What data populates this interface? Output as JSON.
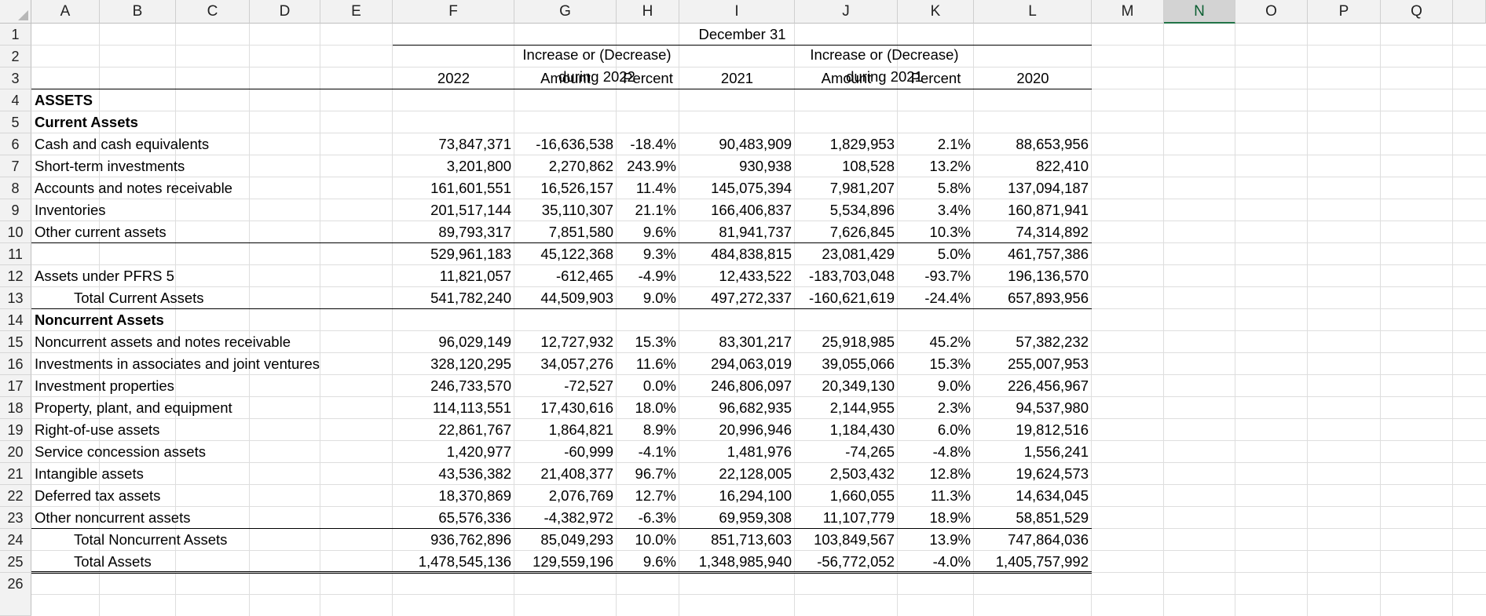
{
  "columns": [
    "A",
    "B",
    "C",
    "D",
    "E",
    "F",
    "G",
    "H",
    "I",
    "J",
    "K",
    "L",
    "M",
    "N",
    "O",
    "P",
    "Q"
  ],
  "selected_column": "N",
  "rows": [
    "1",
    "2",
    "3",
    "4",
    "5",
    "6",
    "7",
    "8",
    "9",
    "10",
    "11",
    "12",
    "13",
    "14",
    "15",
    "16",
    "17",
    "18",
    "19",
    "20",
    "21",
    "22",
    "23",
    "24",
    "25",
    "26"
  ],
  "header": {
    "december": "December 31",
    "inc_2022_line1": "Increase or (Decrease)",
    "inc_2022_line2": "during 2022",
    "inc_2021_line1": "Increase or (Decrease)",
    "inc_2021_line2": "during 2021",
    "y2022": "2022",
    "amount_2022": "Amount",
    "percent_2022": "Percent",
    "y2021": "2021",
    "amount_2021": "Amount",
    "percent_2021": "Percent",
    "y2020": "2020"
  },
  "section_labels": {
    "assets": "ASSETS",
    "current_assets": "Current Assets",
    "noncurrent_assets": "Noncurrent Assets"
  },
  "data_rows": [
    {
      "row": 6,
      "label": "Cash and cash equivalents",
      "indent": false,
      "v2022": "73,847,371",
      "a2022": "-16,636,538",
      "p2022": "-18.4%",
      "v2021": "90,483,909",
      "a2021": "1,829,953",
      "p2021": "2.1%",
      "v2020": "88,653,956"
    },
    {
      "row": 7,
      "label": "Short-term investments",
      "indent": false,
      "v2022": "3,201,800",
      "a2022": "2,270,862",
      "p2022": "243.9%",
      "v2021": "930,938",
      "a2021": "108,528",
      "p2021": "13.2%",
      "v2020": "822,410"
    },
    {
      "row": 8,
      "label": "Accounts and notes receivable",
      "indent": false,
      "v2022": "161,601,551",
      "a2022": "16,526,157",
      "p2022": "11.4%",
      "v2021": "145,075,394",
      "a2021": "7,981,207",
      "p2021": "5.8%",
      "v2020": "137,094,187"
    },
    {
      "row": 9,
      "label": "Inventories",
      "indent": false,
      "v2022": "201,517,144",
      "a2022": "35,110,307",
      "p2022": "21.1%",
      "v2021": "166,406,837",
      "a2021": "5,534,896",
      "p2021": "3.4%",
      "v2020": "160,871,941"
    },
    {
      "row": 10,
      "label": "Other current assets",
      "indent": false,
      "v2022": "89,793,317",
      "a2022": "7,851,580",
      "p2022": "9.6%",
      "v2021": "81,941,737",
      "a2021": "7,626,845",
      "p2021": "10.3%",
      "v2020": "74,314,892"
    },
    {
      "row": 11,
      "label": "",
      "indent": false,
      "v2022": "529,961,183",
      "a2022": "45,122,368",
      "p2022": "9.3%",
      "v2021": "484,838,815",
      "a2021": "23,081,429",
      "p2021": "5.0%",
      "v2020": "461,757,386"
    },
    {
      "row": 12,
      "label": "Assets under PFRS 5",
      "indent": false,
      "v2022": "11,821,057",
      "a2022": "-612,465",
      "p2022": "-4.9%",
      "v2021": "12,433,522",
      "a2021": "-183,703,048",
      "p2021": "-93.7%",
      "v2020": "196,136,570"
    },
    {
      "row": 13,
      "label": "Total Current Assets",
      "indent": true,
      "v2022": "541,782,240",
      "a2022": "44,509,903",
      "p2022": "9.0%",
      "v2021": "497,272,337",
      "a2021": "-160,621,619",
      "p2021": "-24.4%",
      "v2020": "657,893,956"
    },
    {
      "row": 15,
      "label": "Noncurrent assets and notes receivable",
      "indent": false,
      "v2022": "96,029,149",
      "a2022": "12,727,932",
      "p2022": "15.3%",
      "v2021": "83,301,217",
      "a2021": "25,918,985",
      "p2021": "45.2%",
      "v2020": "57,382,232"
    },
    {
      "row": 16,
      "label": "Investments in associates and joint ventures",
      "indent": false,
      "v2022": "328,120,295",
      "a2022": "34,057,276",
      "p2022": "11.6%",
      "v2021": "294,063,019",
      "a2021": "39,055,066",
      "p2021": "15.3%",
      "v2020": "255,007,953"
    },
    {
      "row": 17,
      "label": "Investment properties",
      "indent": false,
      "v2022": "246,733,570",
      "a2022": "-72,527",
      "p2022": "0.0%",
      "v2021": "246,806,097",
      "a2021": "20,349,130",
      "p2021": "9.0%",
      "v2020": "226,456,967"
    },
    {
      "row": 18,
      "label": "Property, plant, and equipment",
      "indent": false,
      "v2022": "114,113,551",
      "a2022": "17,430,616",
      "p2022": "18.0%",
      "v2021": "96,682,935",
      "a2021": "2,144,955",
      "p2021": "2.3%",
      "v2020": "94,537,980"
    },
    {
      "row": 19,
      "label": "Right-of-use assets",
      "indent": false,
      "v2022": "22,861,767",
      "a2022": "1,864,821",
      "p2022": "8.9%",
      "v2021": "20,996,946",
      "a2021": "1,184,430",
      "p2021": "6.0%",
      "v2020": "19,812,516"
    },
    {
      "row": 20,
      "label": "Service concession assets",
      "indent": false,
      "v2022": "1,420,977",
      "a2022": "-60,999",
      "p2022": "-4.1%",
      "v2021": "1,481,976",
      "a2021": "-74,265",
      "p2021": "-4.8%",
      "v2020": "1,556,241"
    },
    {
      "row": 21,
      "label": "Intangible assets",
      "indent": false,
      "v2022": "43,536,382",
      "a2022": "21,408,377",
      "p2022": "96.7%",
      "v2021": "22,128,005",
      "a2021": "2,503,432",
      "p2021": "12.8%",
      "v2020": "19,624,573"
    },
    {
      "row": 22,
      "label": "Deferred tax assets",
      "indent": false,
      "v2022": "18,370,869",
      "a2022": "2,076,769",
      "p2022": "12.7%",
      "v2021": "16,294,100",
      "a2021": "1,660,055",
      "p2021": "11.3%",
      "v2020": "14,634,045"
    },
    {
      "row": 23,
      "label": "Other noncurrent assets",
      "indent": false,
      "v2022": "65,576,336",
      "a2022": "-4,382,972",
      "p2022": "-6.3%",
      "v2021": "69,959,308",
      "a2021": "11,107,779",
      "p2021": "18.9%",
      "v2020": "58,851,529"
    },
    {
      "row": 24,
      "label": "Total Noncurrent Assets",
      "indent": true,
      "v2022": "936,762,896",
      "a2022": "85,049,293",
      "p2022": "10.0%",
      "v2021": "851,713,603",
      "a2021": "103,849,567",
      "p2021": "13.9%",
      "v2020": "747,864,036"
    },
    {
      "row": 25,
      "label": "Total Assets",
      "indent": true,
      "v2022": "1,478,545,136",
      "a2022": "129,559,196",
      "p2022": "9.6%",
      "v2021": "1,348,985,940",
      "a2021": "-56,772,052",
      "p2021": "-4.0%",
      "v2020": "1,405,757,992"
    }
  ]
}
